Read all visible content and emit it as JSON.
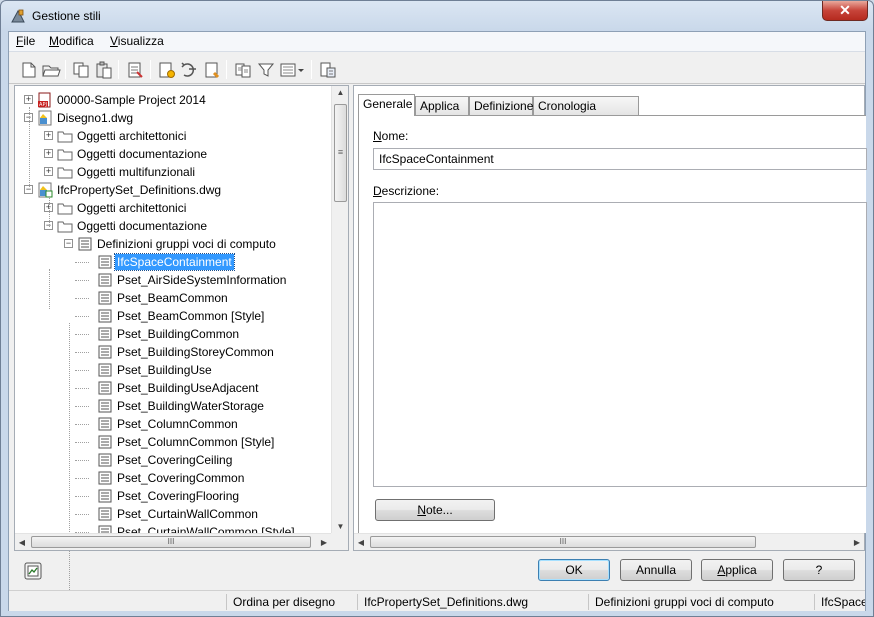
{
  "window": {
    "title": "Gestione stili",
    "close_glyph": "✕"
  },
  "menu": [
    {
      "prefix": "",
      "u": "F",
      "rest": "ile"
    },
    {
      "prefix": "",
      "u": "M",
      "rest": "odifica"
    },
    {
      "prefix": "",
      "u": "V",
      "rest": "isualizza"
    }
  ],
  "toolbar": {
    "icons": [
      "new-drawing-icon",
      "open-drawing-icon",
      "copy-icon",
      "paste-icon",
      "purge-styles-icon",
      "new-style-icon",
      "set-from-icon",
      "edit-style-icon",
      "synchronize-icon",
      "filter-icon",
      "view-toggle-icon",
      "style-properties-icon"
    ]
  },
  "tree": {
    "items": [
      {
        "label": "00000-Sample Project 2014",
        "icon": "project-icon"
      },
      {
        "label": "Disegno1.dwg",
        "icon": "drawing-icon"
      },
      {
        "label": "Oggetti architettonici",
        "icon": "folder-icon"
      },
      {
        "label": "Oggetti documentazione",
        "icon": "folder-icon"
      },
      {
        "label": "Oggetti multifunzionali",
        "icon": "folder-icon"
      },
      {
        "label": "IfcPropertySet_Definitions.dwg",
        "icon": "drawing-linked-icon"
      },
      {
        "label": "Oggetti architettonici",
        "icon": "folder-icon"
      },
      {
        "label": "Oggetti documentazione",
        "icon": "folder-icon"
      },
      {
        "label": "Definizioni gruppi voci di computo",
        "icon": "list-icon"
      },
      {
        "label": "IfcSpaceContainment",
        "icon": "list-icon"
      },
      {
        "label": "Pset_AirSideSystemInformation",
        "icon": "list-icon"
      },
      {
        "label": "Pset_BeamCommon",
        "icon": "list-icon"
      },
      {
        "label": "Pset_BeamCommon [Style]",
        "icon": "list-icon"
      },
      {
        "label": "Pset_BuildingCommon",
        "icon": "list-icon"
      },
      {
        "label": "Pset_BuildingStoreyCommon",
        "icon": "list-icon"
      },
      {
        "label": "Pset_BuildingUse",
        "icon": "list-icon"
      },
      {
        "label": "Pset_BuildingUseAdjacent",
        "icon": "list-icon"
      },
      {
        "label": "Pset_BuildingWaterStorage",
        "icon": "list-icon"
      },
      {
        "label": "Pset_ColumnCommon",
        "icon": "list-icon"
      },
      {
        "label": "Pset_ColumnCommon [Style]",
        "icon": "list-icon"
      },
      {
        "label": "Pset_CoveringCeiling",
        "icon": "list-icon"
      },
      {
        "label": "Pset_CoveringCommon",
        "icon": "list-icon"
      },
      {
        "label": "Pset_CoveringFlooring",
        "icon": "list-icon"
      },
      {
        "label": "Pset_CurtainWallCommon",
        "icon": "list-icon"
      },
      {
        "label": "Pset_CurtainWallCommon [Style]",
        "icon": "list-icon"
      }
    ],
    "selected": "IfcSpaceContainment",
    "expander_plus": "+",
    "expander_minus": "−",
    "grip": "≡",
    "hgrip": "III"
  },
  "tabs": [
    "Generale",
    "Applica a",
    "Definizione",
    "Cronologia versioni"
  ],
  "general": {
    "name_label_u": "N",
    "name_label_rest": "ome:",
    "name_value": "IfcSpaceContainment",
    "desc_label_u": "D",
    "desc_label_rest": "escrizione:",
    "desc_value": "",
    "notes_button_u": "N",
    "notes_button_rest": "ote..."
  },
  "buttons": {
    "ok": "OK",
    "cancel": "Annulla",
    "apply_u": "A",
    "apply_rest": "pplica",
    "help": "?"
  },
  "status": {
    "sort": "Ordina per disegno",
    "drawing": "IfcPropertySet_Definitions.dwg",
    "category": "Definizioni gruppi voci di computo",
    "style": "IfcSpaceContainment"
  },
  "colors": {
    "selection": "#3399ff",
    "close": "#c7443a"
  }
}
